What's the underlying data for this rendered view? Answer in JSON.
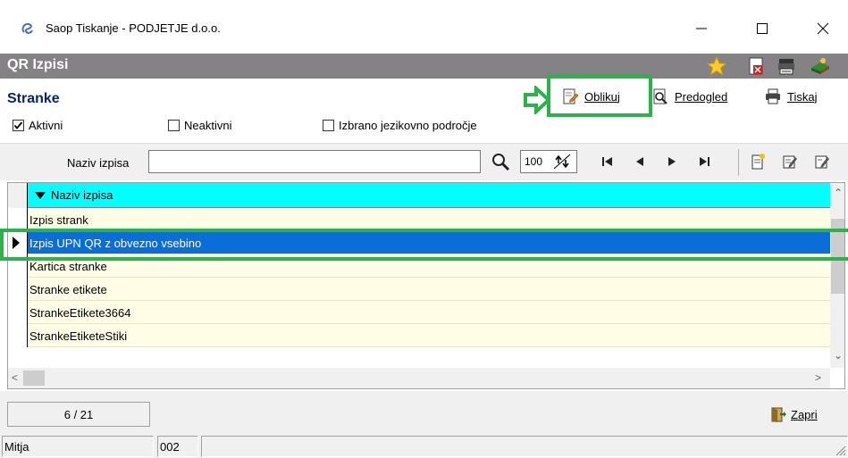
{
  "window": {
    "title": "Saop Tiskanje - PODJETJE d.o.o.",
    "app_icon": "saop-logo-icon",
    "controls": [
      "minimize-icon",
      "maximize-icon",
      "close-icon"
    ]
  },
  "form": {
    "title": "QR Izpisi",
    "header_icons": [
      "star-icon",
      "delete-document-icon",
      "printer-stack-icon",
      "books-icon"
    ]
  },
  "section": {
    "title": "Stranke"
  },
  "filters": [
    {
      "label": "Aktivni",
      "checked": true
    },
    {
      "label": "Neaktivni",
      "checked": false
    },
    {
      "label": "Izbrano jezikovno področje",
      "checked": false
    }
  ],
  "toolbar": {
    "oblikuj_label": "Oblikuj",
    "predogled_label": "Predogled",
    "tiskaj_label": "Tiskaj"
  },
  "search": {
    "label": "Naziv izpisa",
    "value": "",
    "rows_count": "100"
  },
  "grid": {
    "column_header": "Naziv izpisa",
    "rows": [
      {
        "name": "Izpis strank",
        "selected": false
      },
      {
        "name": "Izpis UPN QR z obvezno vsebino",
        "selected": true
      },
      {
        "name": "Kartica stranke",
        "selected": false
      },
      {
        "name": "Stranke etikete",
        "selected": false
      },
      {
        "name": "StrankeEtikete3664",
        "selected": false
      },
      {
        "name": "StrankeEtiketeStiki",
        "selected": false
      }
    ]
  },
  "footer": {
    "counter": "6 / 21",
    "zapri_label": "Zapri"
  },
  "statusbar": {
    "user": "Mitja",
    "code": "002"
  },
  "colors": {
    "highlight_green": "#2cb24a",
    "selected_row": "#0a6dd8",
    "column_header": "#00ffff",
    "row_background": "#fffde6",
    "form_header": "#848284"
  }
}
